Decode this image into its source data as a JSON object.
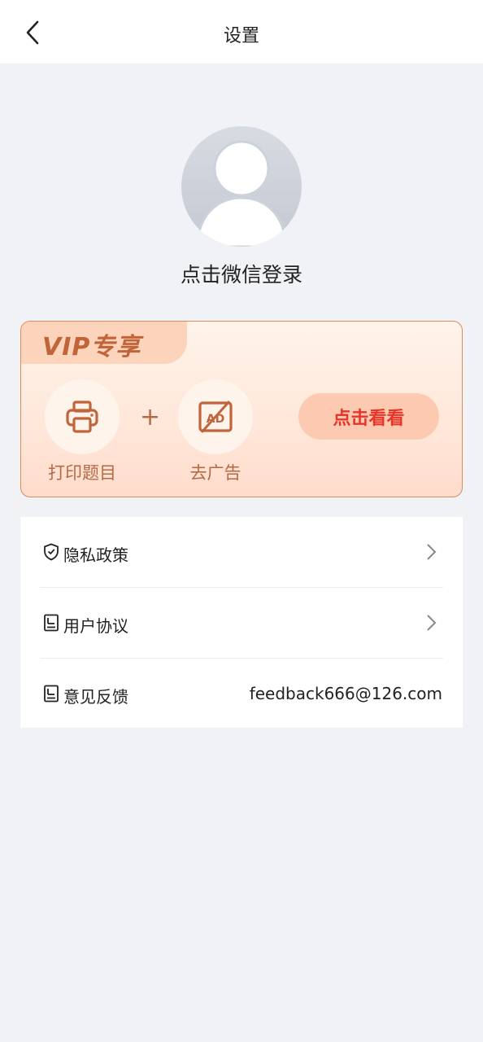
{
  "header": {
    "title": "设置",
    "back_icon": "chevron-left-icon"
  },
  "profile": {
    "avatar_icon": "default-avatar-icon",
    "login_text": "点击微信登录"
  },
  "vip": {
    "title": "VIP专享",
    "features": [
      {
        "label": "打印题目",
        "icon": "printer-icon"
      },
      {
        "label": "去广告",
        "icon": "no-ad-icon"
      }
    ],
    "plus": "+",
    "button_label": "点击看看",
    "colors": {
      "accent": "#c1643a",
      "button_text": "#e8352a",
      "button_bg": "#fccab1"
    }
  },
  "menu": {
    "items": [
      {
        "label": "隐私政策",
        "icon": "shield-icon",
        "trailing": "chevron-right-icon"
      },
      {
        "label": "用户协议",
        "icon": "document-icon",
        "trailing": "chevron-right-icon"
      },
      {
        "label": "意见反馈",
        "icon": "document-icon",
        "value": "feedback666@126.com"
      }
    ]
  }
}
